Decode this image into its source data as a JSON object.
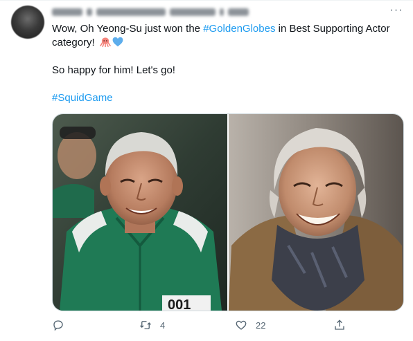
{
  "tweet": {
    "text_line1_pre": "Wow, Oh Yeong-Su just won the ",
    "hashtag_goldenglobes": "#GoldenGlobes",
    "text_line1_post": " in Best Supporting Actor category!",
    "text_line2": "So happy for him! Let's go!",
    "hashtag_squidgame": "#SquidGame",
    "emojis": [
      "octopus-emoji",
      "blue-heart-emoji"
    ]
  },
  "header": {
    "more_label": "···"
  },
  "actions": {
    "reply_count": "",
    "retweet_count": "4",
    "like_count": "22",
    "share_count": ""
  },
  "colors": {
    "link": "#1d9bf0",
    "secondary_text": "#536471",
    "primary_text": "#0f1419",
    "border": "#cfd9de"
  }
}
